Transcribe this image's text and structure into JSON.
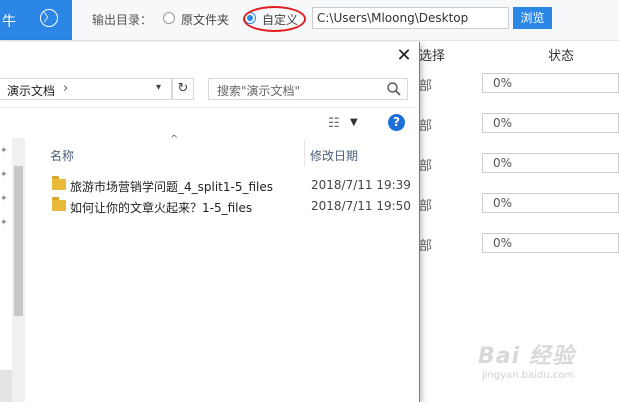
{
  "app": {
    "tab_text": "牛",
    "nav_glyph": "〉",
    "output_label": "输出目录：",
    "radio_source": "原文件夹",
    "radio_custom": "自定义",
    "output_path": "C:\\Users\\Mloong\\Desktop",
    "browse_label": "浏览",
    "col_select": "选择",
    "col_status": "状态",
    "rows": [
      {
        "select": "部",
        "progress": "0%"
      },
      {
        "select": "部",
        "progress": "0%"
      },
      {
        "select": "部",
        "progress": "0%"
      },
      {
        "select": "部",
        "progress": "0%"
      },
      {
        "select": "部",
        "progress": "0%"
      }
    ]
  },
  "dialog": {
    "close_glyph": "✕",
    "address": "演示文档",
    "address_chevron": "›",
    "refresh_glyph": "↻",
    "search_placeholder": "搜索\"演示文档\"",
    "view_glyph": "☷",
    "help_glyph": "?",
    "sort_glyph": "^",
    "header_name": "名称",
    "header_date": "修改日期",
    "files": [
      {
        "name": "旅游市场营销学问题_4_split1-5_files",
        "date": "2018/7/11 19:39",
        "icon": "folder-icon"
      },
      {
        "name": "如何让你的文章火起来？1-5_files",
        "date": "2018/7/11 19:50",
        "icon": "folder-icon"
      }
    ]
  },
  "watermark": {
    "main": "Bai 经验",
    "sub": "jingyan.baidu.com"
  },
  "colors": {
    "accent": "#2b86e6",
    "highlight_ellipse": "#e02020",
    "folder": "#e9b93a"
  }
}
